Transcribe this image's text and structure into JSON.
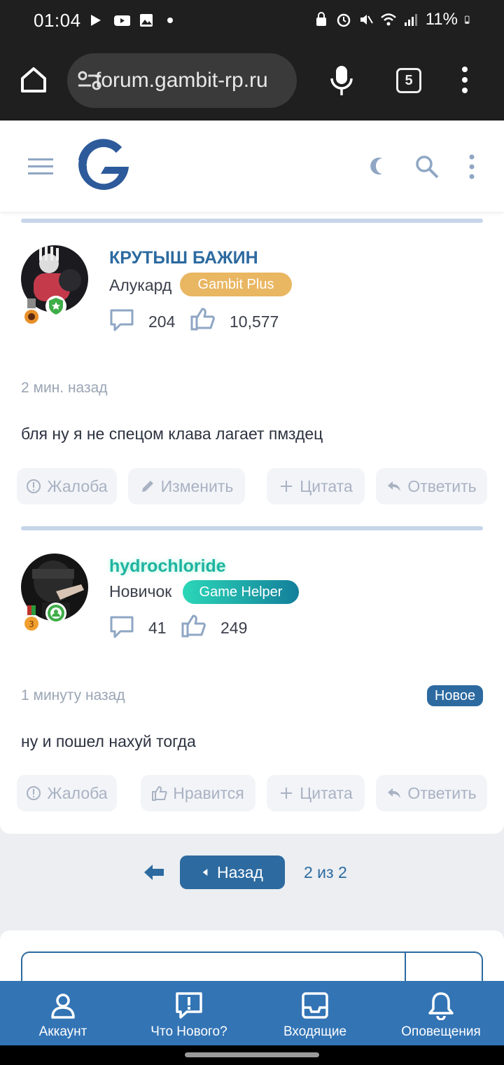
{
  "status_bar": {
    "time": "01:04",
    "battery": "11%"
  },
  "browser": {
    "url": "forum.gambit-rp.ru",
    "tab_count": "5"
  },
  "posts": [
    {
      "username": "КРУТЫШ БАЖИН",
      "rank": "Алукард",
      "group_badge": "Gambit Plus",
      "messages": "204",
      "reactions": "10,577",
      "time": "2 мин. назад",
      "text": "бля ну я не спецом клава лагает пмздец",
      "actions": [
        "Жалоба",
        "Изменить",
        "Цитата",
        "Ответить"
      ]
    },
    {
      "username": "hydrochloride",
      "rank": "Новичок",
      "group_badge": "Game Helper",
      "messages": "41",
      "reactions": "249",
      "time": "1 минуту назад",
      "new_label": "Новое",
      "text": "ну и пошел нахуй тогда",
      "actions": [
        "Жалоба",
        "Нравится",
        "Цитата",
        "Ответить"
      ]
    }
  ],
  "pagination": {
    "back_label": "Назад",
    "info": "2 из 2"
  },
  "bottom_nav": [
    "Аккаунт",
    "Что Нового?",
    "Входящие",
    "Оповещения"
  ],
  "colors": {
    "accent": "#2c6aa0",
    "nav": "#3374b5",
    "gambit_plus": "#e9b662",
    "game_helper": "#1fb3a0"
  }
}
